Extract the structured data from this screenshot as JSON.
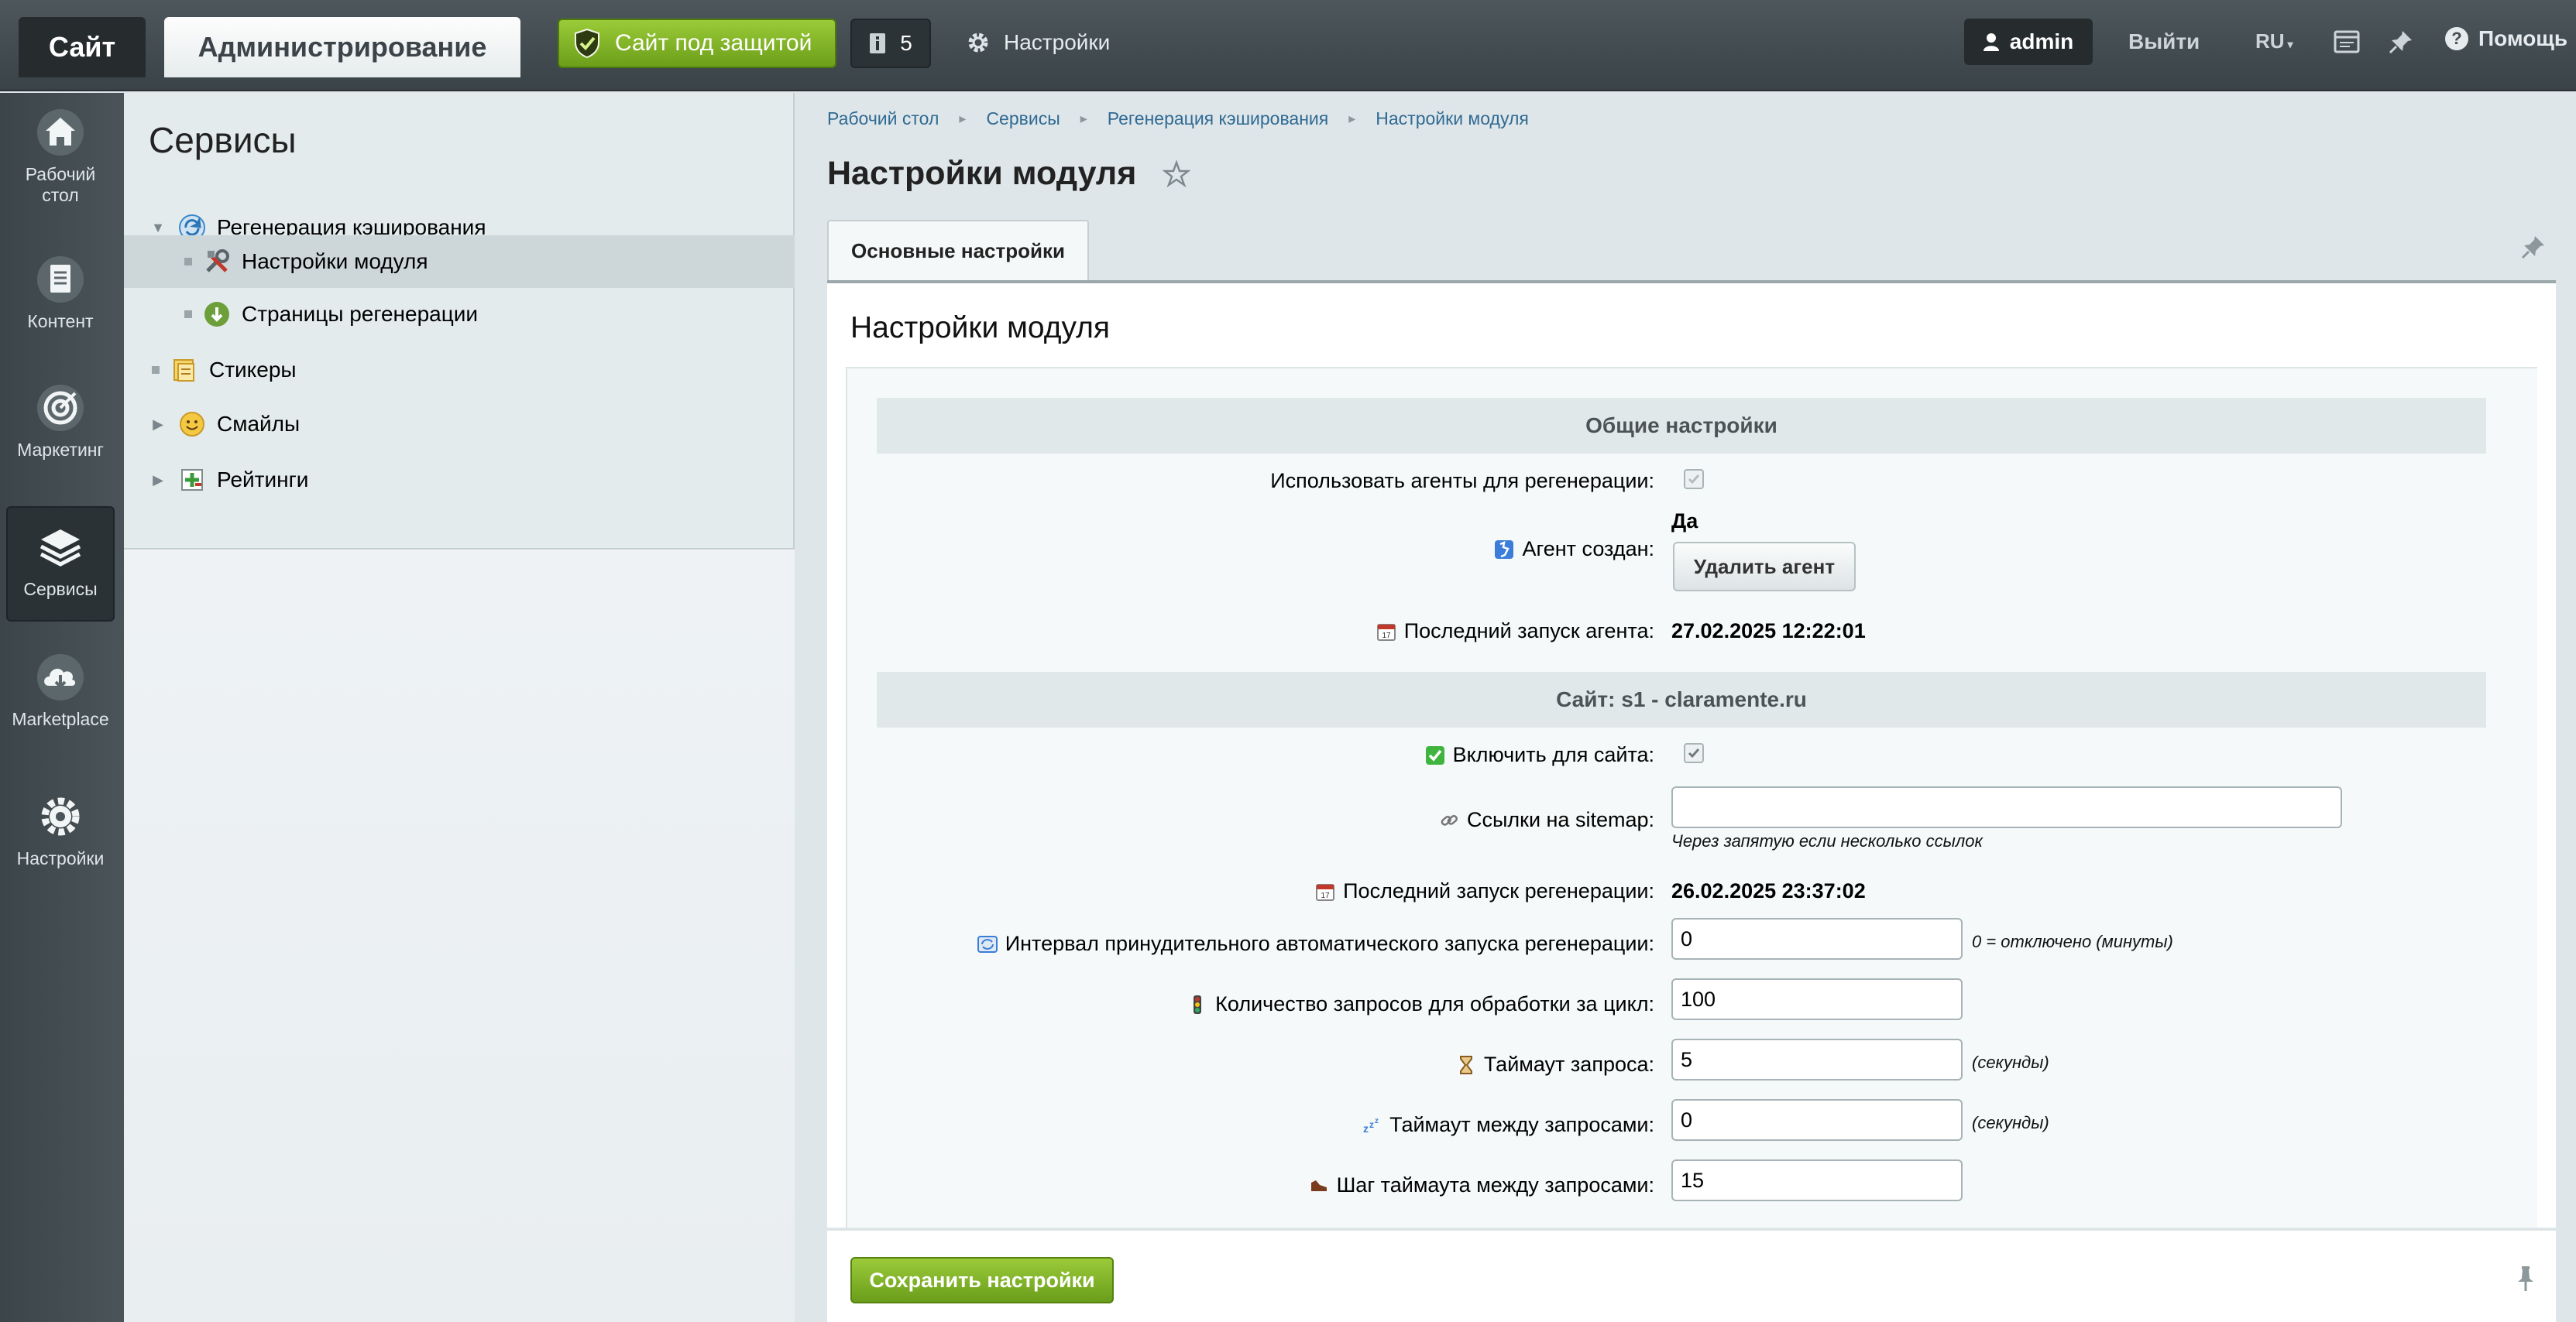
{
  "topbar": {
    "site_tab": "Сайт",
    "admin_tab": "Администрирование",
    "protect_label": "Сайт под защитой",
    "notif_count": "5",
    "settings_label": "Настройки",
    "user_label": "admin",
    "logout_label": "Выйти",
    "lang_label": "RU",
    "help_label": "Помощь"
  },
  "leftmenu": {
    "items": [
      {
        "label": "Рабочий стол",
        "icon": "home-icon"
      },
      {
        "label": "Контент",
        "icon": "document-icon"
      },
      {
        "label": "Маркетинг",
        "icon": "target-icon"
      },
      {
        "label": "Сервисы",
        "icon": "layers-icon"
      },
      {
        "label": "Marketplace",
        "icon": "cloud-download-icon"
      },
      {
        "label": "Настройки",
        "icon": "gear-icon"
      }
    ]
  },
  "tree": {
    "title": "Сервисы",
    "items": [
      {
        "label": "Регенерация кэширования",
        "icon": "refresh-icon"
      },
      {
        "label": "Настройки модуля",
        "icon": "tools-icon"
      },
      {
        "label": "Страницы регенерации",
        "icon": "download-circle-icon"
      },
      {
        "label": "Стикеры",
        "icon": "sticker-icon"
      },
      {
        "label": "Смайлы",
        "icon": "smiley-icon"
      },
      {
        "label": "Рейтинги",
        "icon": "rating-icon"
      }
    ]
  },
  "breadcrumb": [
    "Рабочий стол",
    "Сервисы",
    "Регенерация кэширования",
    "Настройки модуля"
  ],
  "page": {
    "title": "Настройки модуля",
    "tab_label": "Основные настройки",
    "panel_title": "Настройки модуля"
  },
  "general": {
    "heading": "Общие настройки",
    "use_agents_label": "Использовать агенты для регенерации:",
    "agent_created_label": "Агент создан:",
    "agent_created_value": "Да",
    "delete_agent_label": "Удалить агент",
    "last_agent_run_label": "Последний запуск агента:",
    "last_agent_run_value": "27.02.2025 12:22:01"
  },
  "site": {
    "heading": "Сайт: s1 - claramente.ru",
    "enable_label": "Включить для сайта:",
    "sitemap_label": "Ссылки на sitemap:",
    "sitemap_value": "",
    "sitemap_hint": "Через запятую если несколько ссылок",
    "last_regen_label": "Последний запуск регенерации:",
    "last_regen_value": "26.02.2025 23:37:02",
    "interval_label": "Интервал принудительного автоматического запуска регенерации:",
    "interval_value": "0",
    "interval_hint": "0 = отключено (минуты)",
    "requests_label": "Количество запросов для обработки за цикл:",
    "requests_value": "100",
    "timeout_label": "Таймаут запроса:",
    "timeout_value": "5",
    "timeout_hint": "(секунды)",
    "between_label": "Таймаут между запросами:",
    "between_value": "0",
    "between_hint": "(секунды)",
    "step_label": "Шаг таймаута между запросами:",
    "step_value": "15"
  },
  "footer": {
    "save_label": "Сохранить настройки"
  },
  "colors": {
    "accent_green": "#7fb32a",
    "link_blue": "#2f6a93",
    "topbar": "#434c50"
  }
}
